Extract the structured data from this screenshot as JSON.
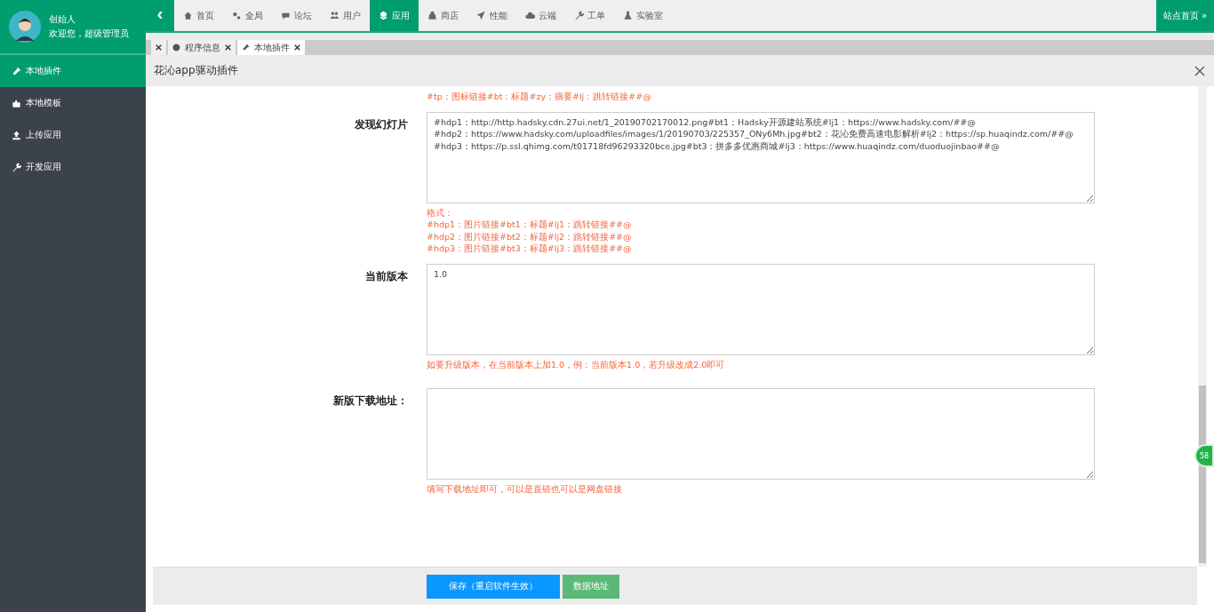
{
  "user": {
    "name": "创始人",
    "greeting": "欢迎您，超级管理员"
  },
  "collapse_glyph": "‹",
  "nav": [
    {
      "label": "首页",
      "selected": false
    },
    {
      "label": "全局",
      "selected": false
    },
    {
      "label": "论坛",
      "selected": false
    },
    {
      "label": "用户",
      "selected": false
    },
    {
      "label": "应用",
      "selected": true
    },
    {
      "label": "商店",
      "selected": false
    },
    {
      "label": "性能",
      "selected": false
    },
    {
      "label": "云端",
      "selected": false
    },
    {
      "label": "工单",
      "selected": false
    },
    {
      "label": "实验室",
      "selected": false
    }
  ],
  "site_home": "站点首页 »",
  "sidebar": [
    {
      "label": "本地插件",
      "selected": true
    },
    {
      "label": "本地模板",
      "selected": false
    },
    {
      "label": "上传应用",
      "selected": false
    },
    {
      "label": "开发应用",
      "selected": false
    }
  ],
  "tabs": [
    {
      "selected": false
    },
    {
      "label": "程序信息",
      "selected": false
    },
    {
      "label": "本地插件",
      "selected": true
    }
  ],
  "dialog": {
    "title": "花沁app驱动插件",
    "top_hint": "#tp：图标链接#bt：标题#zy：摘要#lj：跳转链接##@",
    "fields": [
      {
        "label": "发现幻灯片",
        "value": "#hdp1：http://http.hadsky.cdn.27ui.net/1_20190702170012.png#bt1：Hadsky开源建站系统#lj1：https://www.hadsky.com/##@\n#hdp2：https://www.hadsky.com/uploadfiles/images/1/20190703/225357_ONy6Mh.jpg#bt2：花沁免费高速电影解析#lj2：https://sp.huaqindz.com/##@\n#hdp3：https://p.ssl.qhimg.com/t01718fd96293320bce.jpg#bt3：拼多多优惠商城#lj3：https://www.huaqindz.com/duoduojinbao##@",
        "hints": [
          "格式：",
          "#hdp1：图片链接#bt1：标题#lj1：跳转链接##@",
          "#hdp2：图片链接#bt2：标题#lj2：跳转链接##@",
          "#hdp3：图片链接#bt3：标题#lj3：跳转链接##@"
        ]
      },
      {
        "label": "当前版本",
        "value": "1.0",
        "hints": [
          "如要升级版本，在当前版本上加1.0，例：当前版本1.0，若升级改成2.0即可"
        ]
      },
      {
        "label": "新版下载地址：",
        "hints": [
          "填写下载地址即可，可以是直链也可以是网盘链接"
        ]
      }
    ],
    "buttons": [
      {
        "label": "保存（重启软件生效）",
        "kind": "primary"
      },
      {
        "label": "数据地址",
        "kind": "success"
      }
    ]
  },
  "float_badge": "58"
}
